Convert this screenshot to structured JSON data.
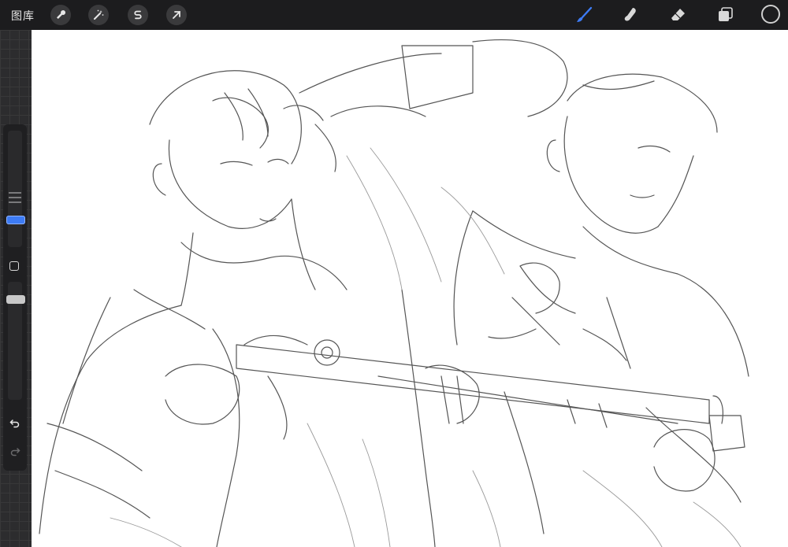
{
  "toolbar": {
    "gallery_label": "图库",
    "left_tools": [
      {
        "name": "actions",
        "icon": "wrench-icon"
      },
      {
        "name": "adjustments",
        "icon": "magic-wand-icon"
      },
      {
        "name": "selection",
        "icon": "selection-s-icon"
      },
      {
        "name": "transform",
        "icon": "arrow-cursor-icon"
      }
    ],
    "right_tools": [
      {
        "name": "brush",
        "icon": "brush-icon",
        "active": true
      },
      {
        "name": "smudge",
        "icon": "smudge-icon"
      },
      {
        "name": "eraser",
        "icon": "eraser-icon"
      },
      {
        "name": "layers",
        "icon": "layers-icon"
      }
    ],
    "current_color": "#1c1c1e",
    "accent_color": "#3d7bf5"
  },
  "sidebar": {
    "brush_size_icon": "size-slider-handle",
    "modify_icon": "square-icon",
    "opacity_icon": "opacity-slider-handle",
    "undo_icon": "undo-arrow-icon",
    "redo_icon": "redo-arrow-icon"
  },
  "canvas": {
    "description": "",
    "background": "#ffffff"
  }
}
